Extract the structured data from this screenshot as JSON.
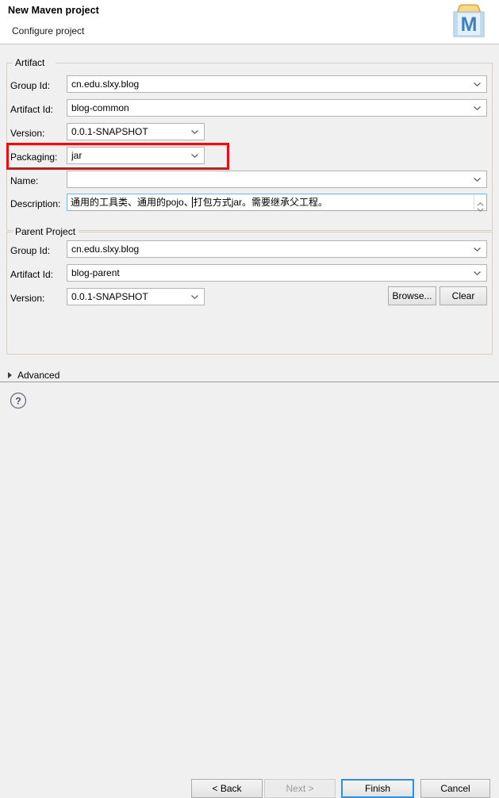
{
  "window": {
    "title": "New Maven project",
    "subtitle": "Configure project",
    "logo_icon": "maven-logo-icon",
    "logo_letter": "M"
  },
  "artifact_group": {
    "legend": "Artifact",
    "group_id": {
      "label": "Group Id:",
      "value": "cn.edu.slxy.blog"
    },
    "artifact_id": {
      "label": "Artifact Id:",
      "value": "blog-common"
    },
    "version": {
      "label": "Version:",
      "value": "0.0.1-SNAPSHOT"
    },
    "packaging": {
      "label": "Packaging:",
      "value": "jar"
    },
    "name": {
      "label": "Name:",
      "value": "",
      "placeholder": ""
    },
    "description": {
      "label": "Description:",
      "value": "通用的工具类、通用的pojo、打包方式jar。需要继承父工程。"
    }
  },
  "parent_group": {
    "legend": "Parent Project",
    "group_id": {
      "label": "Group Id:",
      "value": "cn.edu.slxy.blog"
    },
    "artifact_id": {
      "label": "Artifact Id:",
      "value": "blog-parent"
    },
    "version": {
      "label": "Version:",
      "value": "0.0.1-SNAPSHOT"
    },
    "browse_label": "Browse...",
    "clear_label": "Clear"
  },
  "advanced": {
    "label": "Advanced",
    "expanded": false,
    "twisty_icon": "triangle-right-icon"
  },
  "footer": {
    "help_icon": "help-question-icon",
    "back_label": "< Back",
    "next_label": "Next >",
    "finish_label": "Finish",
    "cancel_label": "Cancel"
  },
  "annotation": {
    "highlight_color": "#e50f0f",
    "highlight_target": "packaging-row"
  },
  "colors": {
    "accent": "#2f8fdd",
    "dialog_bg": "#f0f0f0",
    "header_bg": "#ffffff",
    "field_border": "#b4b4b4",
    "focus_border": "#7eb4e2"
  }
}
